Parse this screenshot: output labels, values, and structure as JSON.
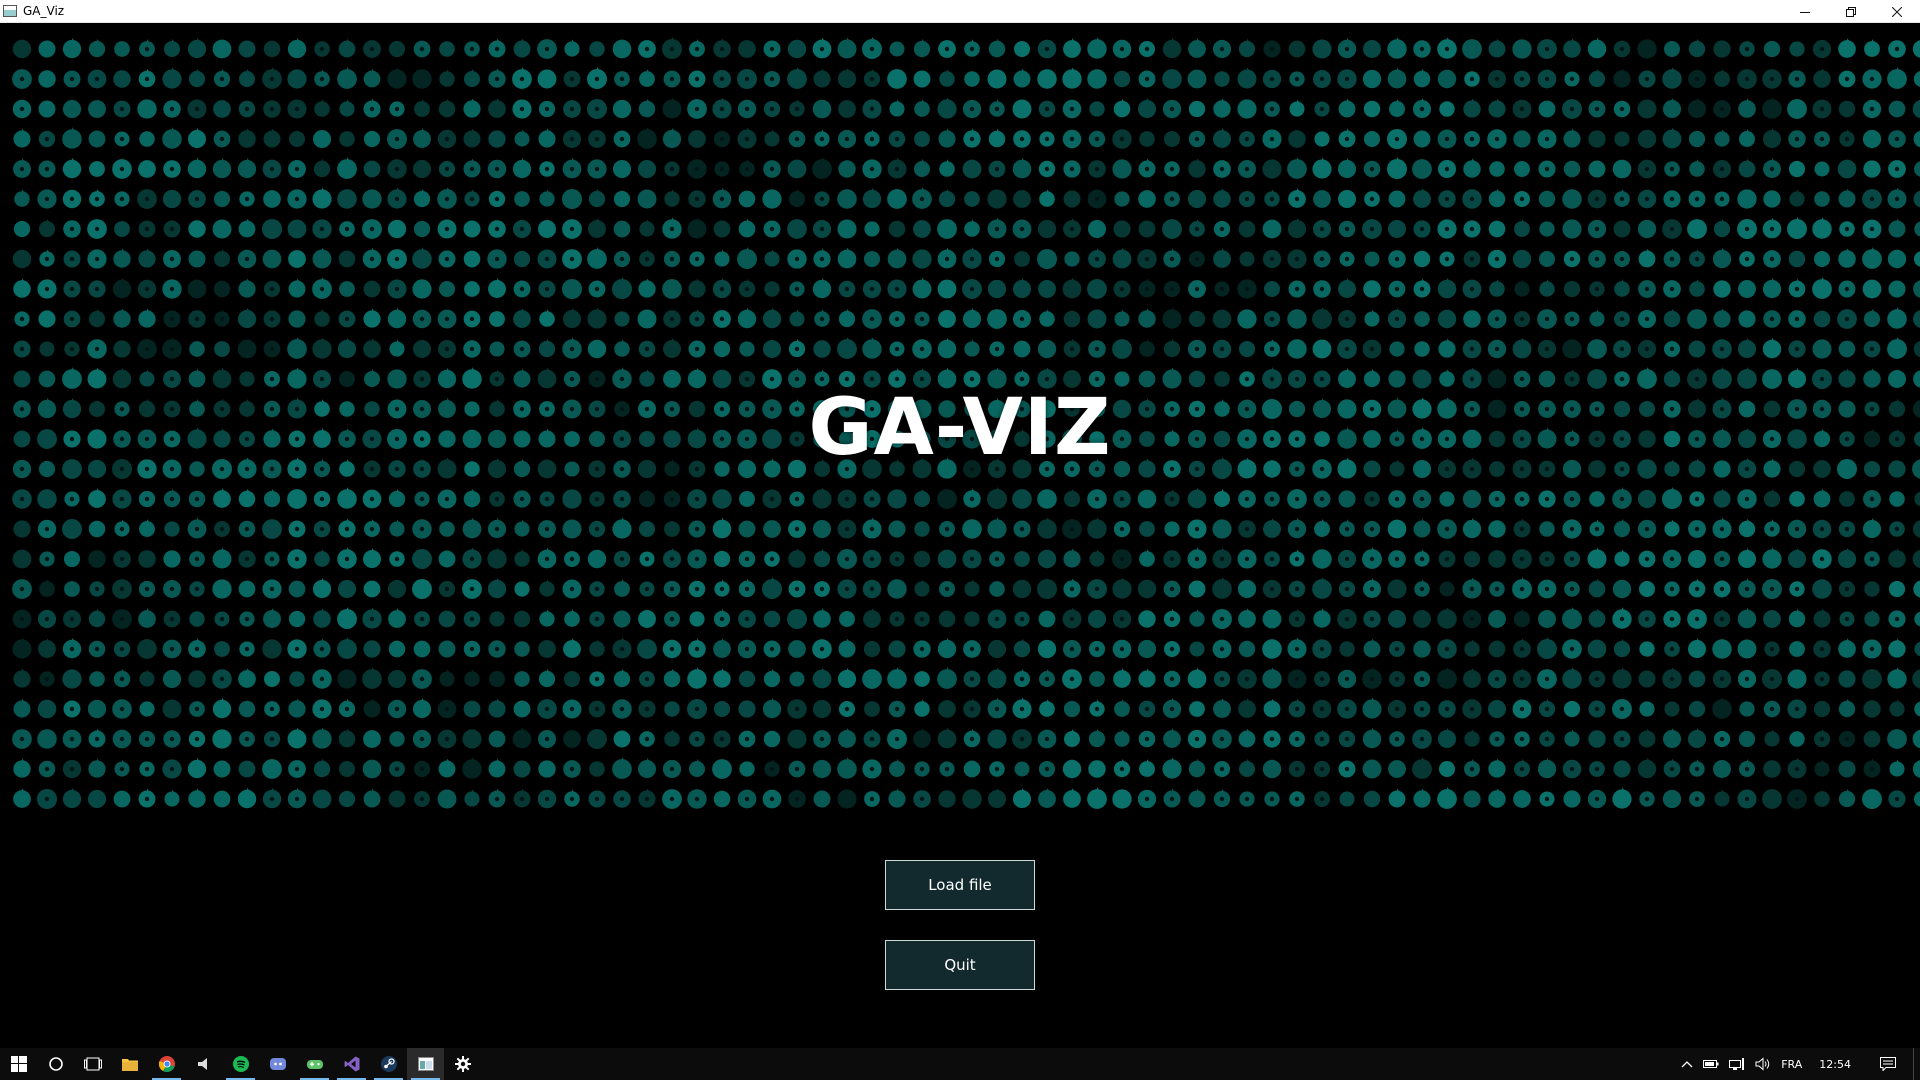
{
  "window": {
    "title": "GA_Viz",
    "icon": "app-window-icon"
  },
  "window_controls": [
    {
      "name": "minimize",
      "icon": "minimize-icon"
    },
    {
      "name": "restore",
      "icon": "restore-icon"
    },
    {
      "name": "close",
      "icon": "close-icon"
    }
  ],
  "app": {
    "logo": "GA-VIZ",
    "load_button": "Load file",
    "quit_button": "Quit",
    "accent_color": "#0a6b66",
    "background_color": "#000000"
  },
  "taskbar": {
    "apps": [
      {
        "name": "start",
        "icon": "windows-start-icon"
      },
      {
        "name": "search",
        "icon": "cortana-circle-icon"
      },
      {
        "name": "task-view",
        "icon": "task-view-icon"
      },
      {
        "name": "file-explorer",
        "icon": "folder-icon"
      },
      {
        "name": "chrome",
        "icon": "chrome-icon",
        "active": true
      },
      {
        "name": "media",
        "icon": "speaker-icon"
      },
      {
        "name": "spotify",
        "icon": "spotify-icon",
        "active": true
      },
      {
        "name": "discord",
        "icon": "discord-icon"
      },
      {
        "name": "gamepad",
        "icon": "gamepad-icon",
        "active": true
      },
      {
        "name": "visual-studio",
        "icon": "visual-studio-icon",
        "active": true
      },
      {
        "name": "steam",
        "icon": "steam-icon",
        "active": true
      },
      {
        "name": "ga-viz",
        "icon": "app-window-icon",
        "active": true,
        "current": true
      },
      {
        "name": "settings",
        "icon": "gear-icon"
      }
    ],
    "tray": {
      "language": "FRA",
      "time": "12:54"
    }
  }
}
